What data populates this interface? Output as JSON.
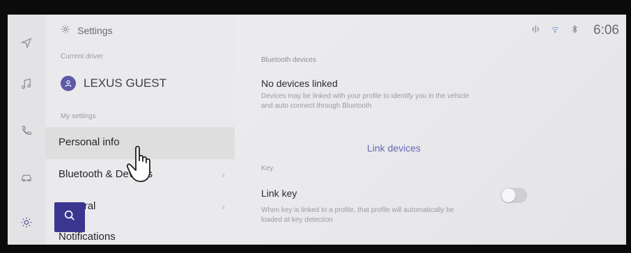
{
  "header": {
    "title": "Settings"
  },
  "driver": {
    "section_label": "Current driver",
    "name": "LEXUS GUEST"
  },
  "menu": {
    "section_label": "My settings",
    "items": [
      {
        "label": "Personal info"
      },
      {
        "label": "Bluetooth & Devices"
      },
      {
        "label": "General"
      },
      {
        "label": "Notifications"
      }
    ]
  },
  "status": {
    "time": "6:06"
  },
  "content": {
    "bluetooth": {
      "section_label": "Bluetooth devices",
      "title": "No devices linked",
      "description": "Devices may be linked with your profile to identify you in the vehicle and auto connect through Bluetooth",
      "link_label": "Link devices"
    },
    "key": {
      "section_label": "Key",
      "title": "Link key",
      "description": "When key is linked to a profile, that profile will automatically be loaded at key detection",
      "toggle_on": false
    }
  },
  "colors": {
    "accent": "#5e5aa5",
    "search_button": "#3a3790"
  },
  "icons": {
    "rail": [
      "navigation-icon",
      "music-icon",
      "phone-icon",
      "car-icon",
      "gear-icon"
    ],
    "status": [
      "wireless-charging-icon",
      "wifi-icon",
      "bluetooth-icon"
    ]
  }
}
